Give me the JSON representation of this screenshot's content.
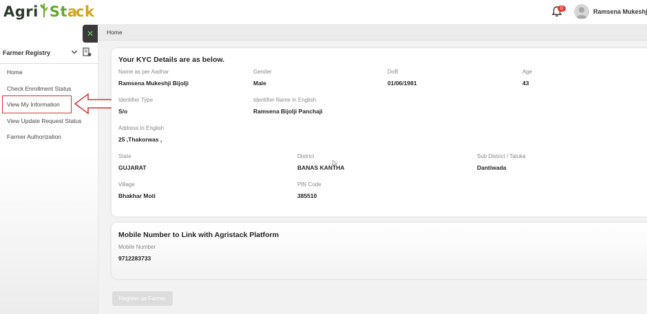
{
  "header": {
    "logo": {
      "part1": "Agri",
      "part2": "St",
      "part3": "ck"
    },
    "notification_count": "0",
    "user_name": "Ramsena Mukeshji Bi"
  },
  "sidebar": {
    "section_title": "Farmer Registry",
    "items": [
      {
        "label": "Home"
      },
      {
        "label": "Check Enrollment Status"
      },
      {
        "label": "View My Information"
      },
      {
        "label": "View Update Request Status"
      },
      {
        "label": "Farmer Authorization"
      }
    ]
  },
  "breadcrumb": "Home",
  "kyc": {
    "title": "Your KYC Details are as below.",
    "fields": {
      "name": {
        "label": "Name as per Aadhar",
        "value": "Ramsena Mukeshji Bijolji"
      },
      "gender": {
        "label": "Gender",
        "value": "Male"
      },
      "dob": {
        "label": "DoB",
        "value": "01/06/1981"
      },
      "age": {
        "label": "Age",
        "value": "43"
      },
      "identifier_type": {
        "label": "Identifier Type",
        "value": "S/o"
      },
      "identifier_name": {
        "label": "Identifier Name in English",
        "value": "Ramsena Bijolji Panchaji"
      },
      "address": {
        "label": "Address in English",
        "value": "25 ,Thakorwas ,"
      },
      "state": {
        "label": "State",
        "value": "GUJARAT"
      },
      "district": {
        "label": "District",
        "value": "BANAS KANTHA"
      },
      "sub_district": {
        "label": "Sub District / Taluka",
        "value": "Dantiwada"
      },
      "village": {
        "label": "Village",
        "value": "Bhakhar Moti"
      },
      "pin": {
        "label": "PIN Code",
        "value": "385510"
      }
    }
  },
  "mobile": {
    "title": "Mobile Number to Link with Agristack Platform",
    "label": "Mobile Number",
    "value": "9712283733"
  },
  "register_button": "Register as Farmer",
  "colors": {
    "accent_green": "#6aa531",
    "highlight_red": "#d32f2f",
    "logo_gold": "#d1a520"
  }
}
